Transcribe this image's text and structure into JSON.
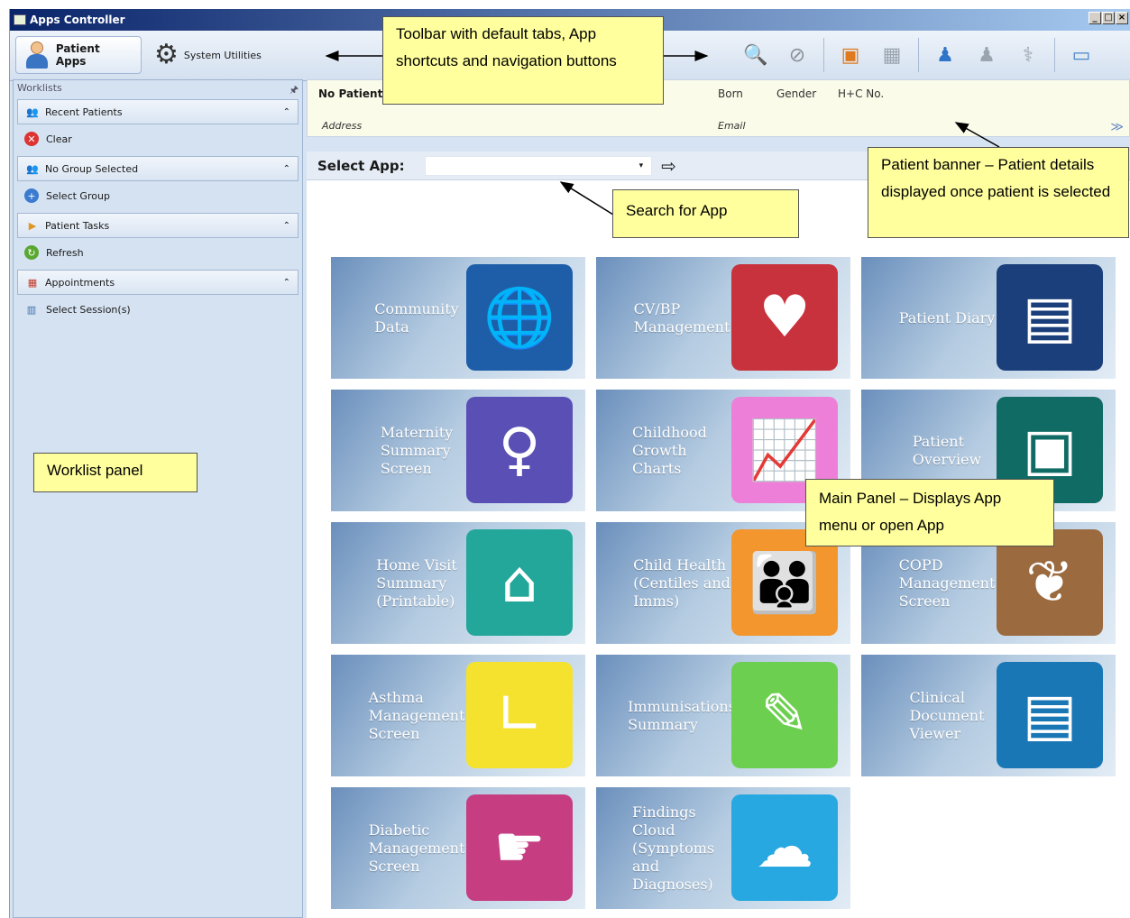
{
  "window": {
    "title": "Apps Controller",
    "buttons": [
      "_",
      "□",
      "×"
    ]
  },
  "toolbar": {
    "tabs": [
      {
        "label": "Patient Apps",
        "icon": "patient-icon",
        "active": true
      },
      {
        "label": "System Utilities",
        "icon": "gear-icon",
        "active": false
      }
    ],
    "icons": [
      "find-patient-icon",
      "remove-patient-icon",
      "add-app-icon",
      "add-calendar-icon",
      "add-user-icon",
      "user-icon",
      "add-medicine-icon",
      "window-icon"
    ]
  },
  "worklist": {
    "title": "Worklists",
    "pin": "𐀀",
    "groups": [
      {
        "label": "Recent Patients",
        "item": "Clear"
      },
      {
        "label": "No Group Selected",
        "item": "Select Group"
      },
      {
        "label": "Patient Tasks",
        "item": "Refresh"
      },
      {
        "label": "Appointments",
        "item": "Select Session(s)"
      }
    ]
  },
  "banner": {
    "no_patient": "No Patient",
    "born": "Born",
    "gender": "Gender",
    "hc": "H+C No.",
    "address": "Address",
    "email": "Email"
  },
  "select_app": {
    "label": "Select App:",
    "value": ""
  },
  "tiles": [
    {
      "label": "Community\nData",
      "color": "#1e5ea8",
      "icon": "globe-icon"
    },
    {
      "label": "CV/BP\nManagement",
      "color": "#c8323c",
      "icon": "heart-icon"
    },
    {
      "label": "Patient Diary",
      "color": "#1b3f7a",
      "icon": "notebook-icon"
    },
    {
      "label": "Maternity\nSummary\nScreen",
      "color": "#5a4fb5",
      "icon": "mother-child-icon"
    },
    {
      "label": "Childhood\nGrowth Charts",
      "color": "#ee7fd8",
      "icon": "growth-chart-icon"
    },
    {
      "label": "Patient\nOverview",
      "color": "#0f6b64",
      "icon": "patient-card-icon"
    },
    {
      "label": "Home Visit\nSummary\n(Printable)",
      "color": "#23a79a",
      "icon": "house-icon"
    },
    {
      "label": "Child Health\n(Centiles and\nImms)",
      "color": "#f2962d",
      "icon": "parent-child-icon"
    },
    {
      "label": "COPD\nManagement\nScreen",
      "color": "#9b6a3f",
      "icon": "lungs-icon"
    },
    {
      "label": "Asthma\nManagement\nScreen",
      "color": "#f4e22f",
      "icon": "inhaler-icon"
    },
    {
      "label": "Immunisations\nSummary",
      "color": "#6ccf4f",
      "icon": "syringe-icon"
    },
    {
      "label": "Clinical\nDocument\nViewer",
      "color": "#1a77b6",
      "icon": "document-icon"
    },
    {
      "label": "Diabetic\nManagement\nScreen",
      "color": "#c63d82",
      "icon": "blood-test-icon"
    },
    {
      "label": "Findings Cloud\n(Symptoms\nand\nDiagnoses)",
      "color": "#27a8e0",
      "icon": "cloud-icon"
    }
  ],
  "annotations": {
    "toolbar": "Toolbar with default tabs, App shortcuts and navigation buttons",
    "banner": "Patient banner – Patient details displayed once patient is selected",
    "search": "Search for App",
    "worklist": "Worklist panel",
    "main": "Main Panel – Displays App menu or open App"
  }
}
